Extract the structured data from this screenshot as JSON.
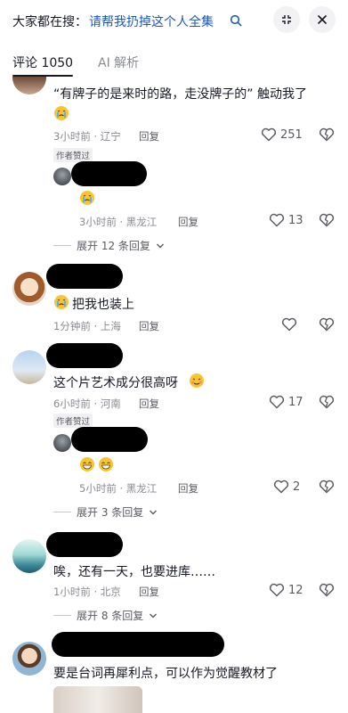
{
  "header": {
    "search_prefix": "大家都在搜：",
    "search_query": "请帮我扔掉这个人全集",
    "icons": [
      "search-icon",
      "close-icon",
      "more-icon"
    ]
  },
  "tabs": [
    {
      "label": "评论 1050"
    },
    {
      "label": "AI 解析"
    }
  ],
  "comments": [
    {
      "text": "“有牌子的是来时的路，走没牌子的”  触动我了",
      "time_location": "3小时前 · 辽宁",
      "reply_label": "回复",
      "likes": "251",
      "reply": {
        "author_tag": "作者赞过",
        "emoji": "crying-face",
        "time_location": "3小时前 · 黑龙江",
        "reply_label": "回复",
        "likes": "13"
      },
      "expand_label": "展开 12 条回复"
    },
    {
      "text": "把我也装上",
      "time_location": "1分钟前 · 上海",
      "reply_label": "回复",
      "likes": ""
    },
    {
      "text": "这个片艺术成分很高呀",
      "time_location": "6小时前 · 河南",
      "reply_label": "回复",
      "likes": "17",
      "reply": {
        "author_tag": "作者赞过",
        "emoji": "grinning-faces",
        "time_location": "5小时前 · 黑龙江",
        "reply_label": "回复",
        "likes": "2"
      },
      "expand_label": "展开 3 条回复"
    },
    {
      "text": "唉，还有一天，也要进库……",
      "time_location": "1小时前 · 北京",
      "reply_label": "回复",
      "likes": "12",
      "expand_label": "展开 8 条回复"
    },
    {
      "text": "要是台词再犀利点，可以作为觉醒教材了"
    }
  ]
}
